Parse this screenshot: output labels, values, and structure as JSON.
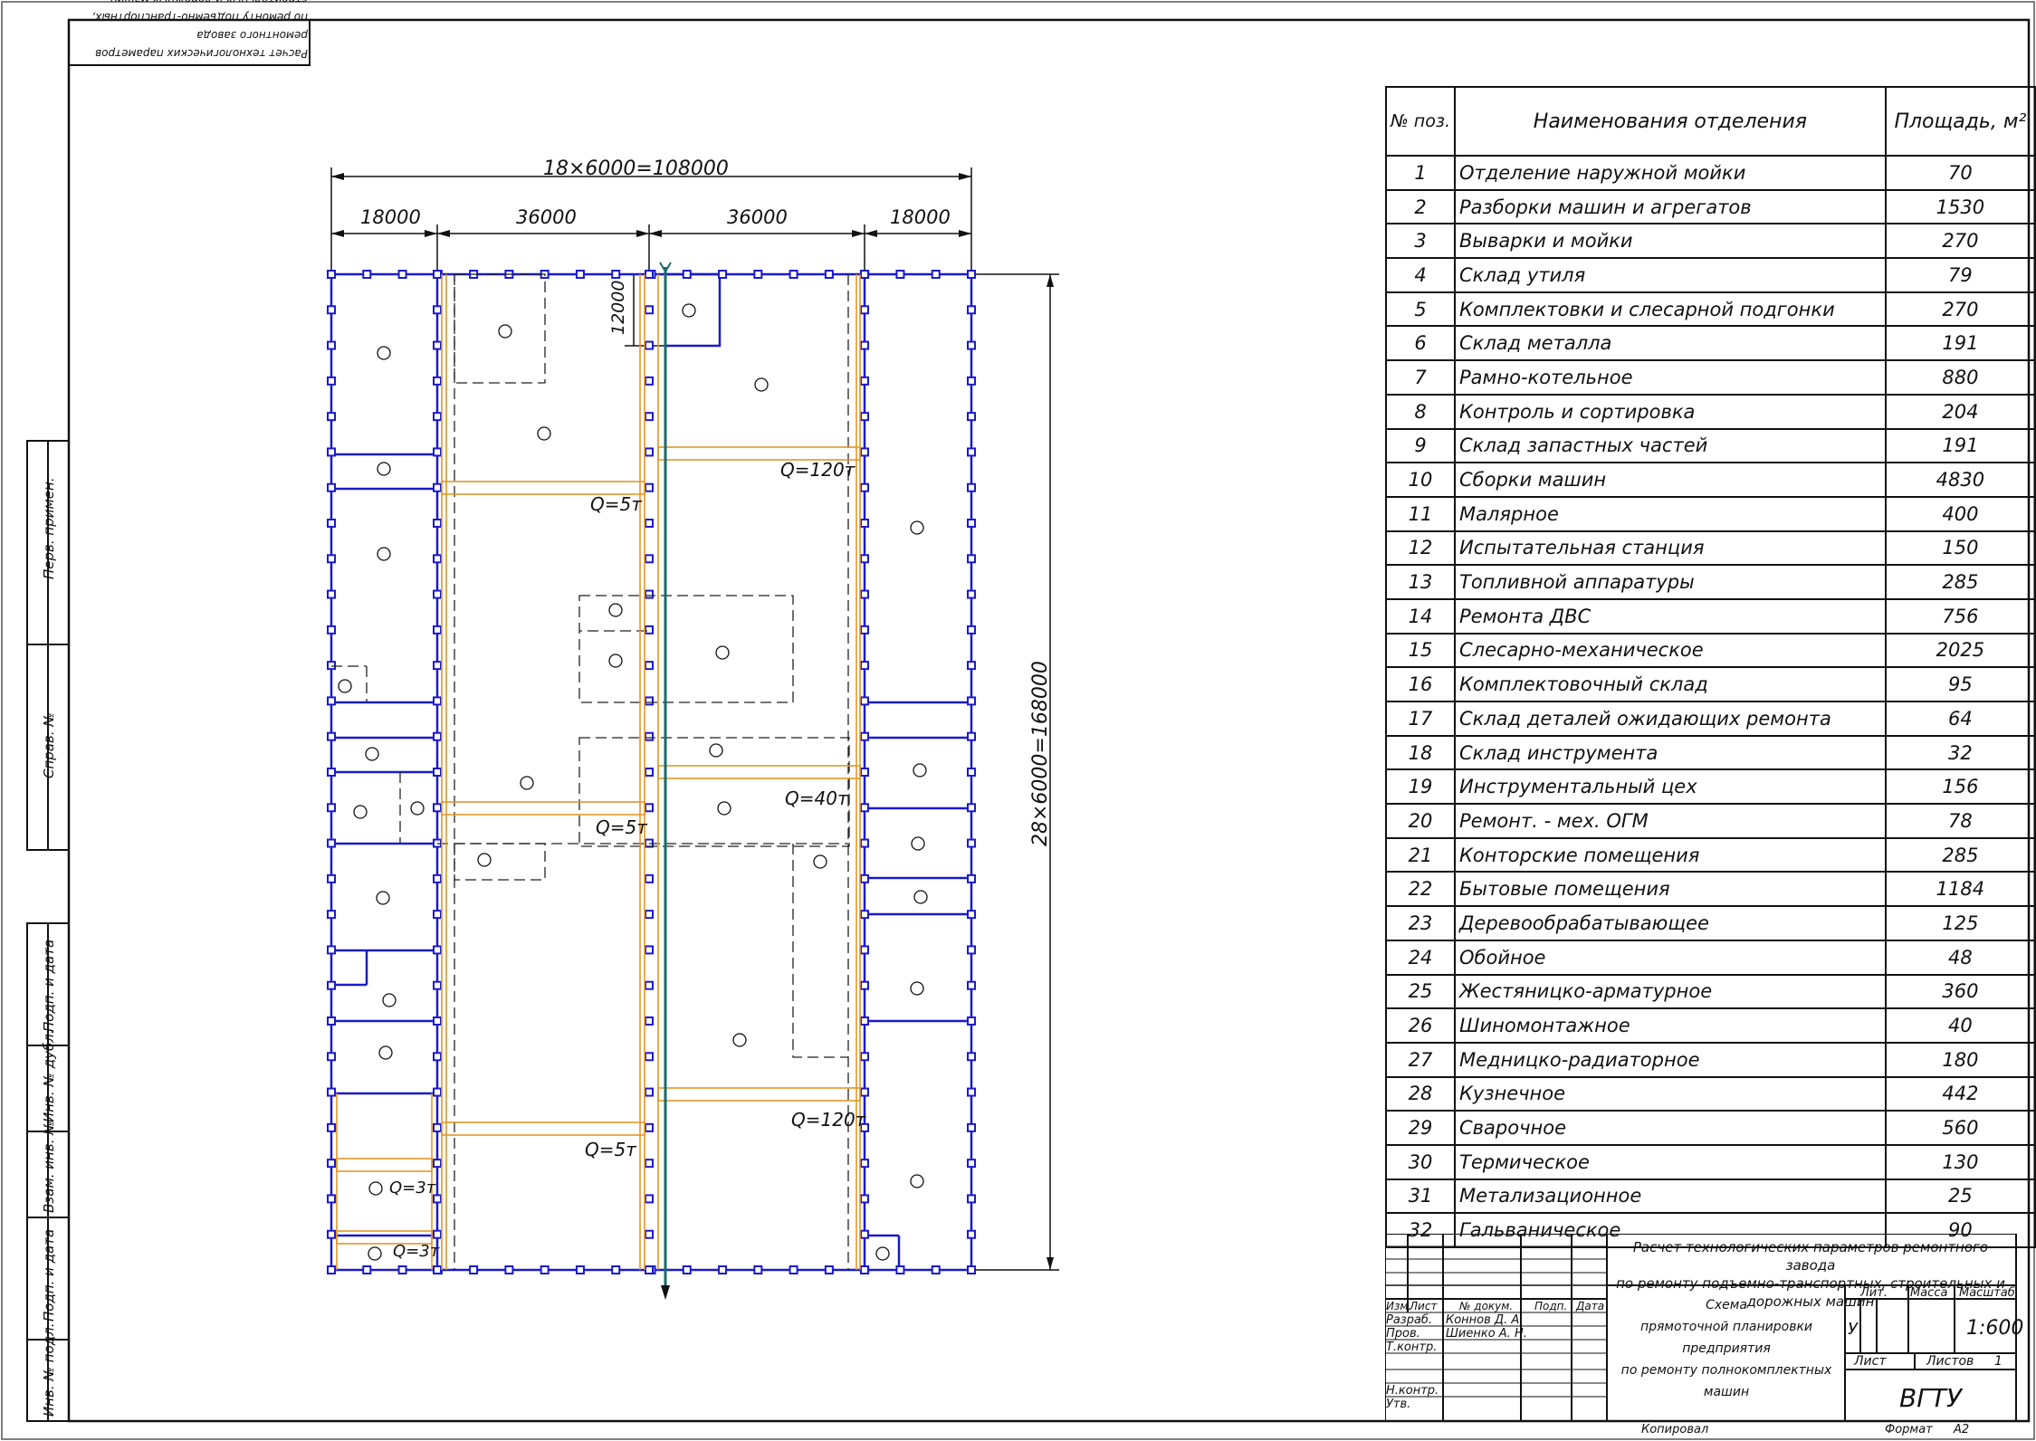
{
  "stamp_top": {
    "line1": "Расчет технологических параметров ремонтного завода",
    "line2": "по ремонту подъемно-транспортных, строительных и дорожных машин"
  },
  "side_labels": {
    "perv_primen": "Перв. примен.",
    "sprav_no": "Справ. №",
    "podp_data_1": "Подп. и дата",
    "inv_dubl": "Инв. № дубл.",
    "vzam_inv": "Взам. инв. №",
    "podp_data_2": "Подп. и дата",
    "inv_podl": "Инв. № подл."
  },
  "plan": {
    "dim_total_width": "18×6000=108000",
    "dim_spans": [
      "18000",
      "36000",
      "36000",
      "18000"
    ],
    "dim_height": "28×6000=168000",
    "dim_12000": "12000",
    "cranes": [
      "Q=5т",
      "Q=120т",
      "Q=5т",
      "Q=40т",
      "Q=5т",
      "Q=120т",
      "Q=3т",
      "Q=3т"
    ]
  },
  "spec_table": {
    "headers": [
      "№ поз.",
      "Наименования отделения",
      "Площадь, м²"
    ],
    "rows": [
      [
        "1",
        "Отделение наружной мойки",
        "70"
      ],
      [
        "2",
        "Разборки машин и агрегатов",
        "1530"
      ],
      [
        "3",
        "Выварки и мойки",
        "270"
      ],
      [
        "4",
        "Склад утиля",
        "79"
      ],
      [
        "5",
        "Комплектовки и слесарной подгонки",
        "270"
      ],
      [
        "6",
        "Склад металла",
        "191"
      ],
      [
        "7",
        "Рамно-котельное",
        "880"
      ],
      [
        "8",
        "Контроль и сортировка",
        "204"
      ],
      [
        "9",
        "Склад запастных частей",
        "191"
      ],
      [
        "10",
        "Сборки машин",
        "4830"
      ],
      [
        "11",
        "Малярное",
        "400"
      ],
      [
        "12",
        "Испытательная станция",
        "150"
      ],
      [
        "13",
        "Топливной аппаратуры",
        "285"
      ],
      [
        "14",
        "Ремонта ДВС",
        "756"
      ],
      [
        "15",
        "Слесарно-механическое",
        "2025"
      ],
      [
        "16",
        "Комплектовочный склад",
        "95"
      ],
      [
        "17",
        "Склад деталей ожидающих ремонта",
        "64"
      ],
      [
        "18",
        "Склад инструмента",
        "32"
      ],
      [
        "19",
        "Инструментальный цех",
        "156"
      ],
      [
        "20",
        "Ремонт. - мех. ОГМ",
        "78"
      ],
      [
        "21",
        "Конторские помещения",
        "285"
      ],
      [
        "22",
        "Бытовые помещения",
        "1184"
      ],
      [
        "23",
        "Деревообрабатывающее",
        "125"
      ],
      [
        "24",
        "Обойное",
        "48"
      ],
      [
        "25",
        "Жестяницко-арматурное",
        "360"
      ],
      [
        "26",
        "Шиномонтажное",
        "40"
      ],
      [
        "27",
        "Медницко-радиаторное",
        "180"
      ],
      [
        "28",
        "Кузнечное",
        "442"
      ],
      [
        "29",
        "Сварочное",
        "560"
      ],
      [
        "30",
        "Термическое",
        "130"
      ],
      [
        "31",
        "Метализационное",
        "25"
      ],
      [
        "32",
        "Гальваническое",
        "90"
      ]
    ]
  },
  "title_block": {
    "title1": "Расчет технологических параметров ремонтного завода",
    "title2": "по ремонту подъемно-транспортных, строительных и дорожных машин",
    "col_izm": "Изм.",
    "col_list": "Лист",
    "col_docum": "№ докум.",
    "col_podp": "Подп.",
    "col_data": "Дата",
    "razrab_label": "Разраб.",
    "razrab_name": "Коннов Д. А.",
    "prov_label": "Пров.",
    "prov_name": "Шиенко А. Н.",
    "tkontr_label": "Т.контр.",
    "nkontr_label": "Н.контр.",
    "utv_label": "Утв.",
    "doc_title1": "Схема",
    "doc_title2": "прямоточной планировки предприятия",
    "doc_title3": "по ремонту полнокомплектных машин",
    "lit_label": "Лит.",
    "massa_label": "Масса",
    "masshtab_label": "Масштаб",
    "lit_value": "У",
    "masshtab_value": "1:600",
    "sheet_label": "Лист",
    "sheets_label": "Листов",
    "sheets_value": "1",
    "org": "ВГТУ",
    "kopiroval": "Копировал",
    "format_label": "Формат",
    "format_value": "А2"
  },
  "colors": {
    "wall": "#1a1acc",
    "crane": "#e0972a",
    "axis": "#1a6a6a"
  }
}
